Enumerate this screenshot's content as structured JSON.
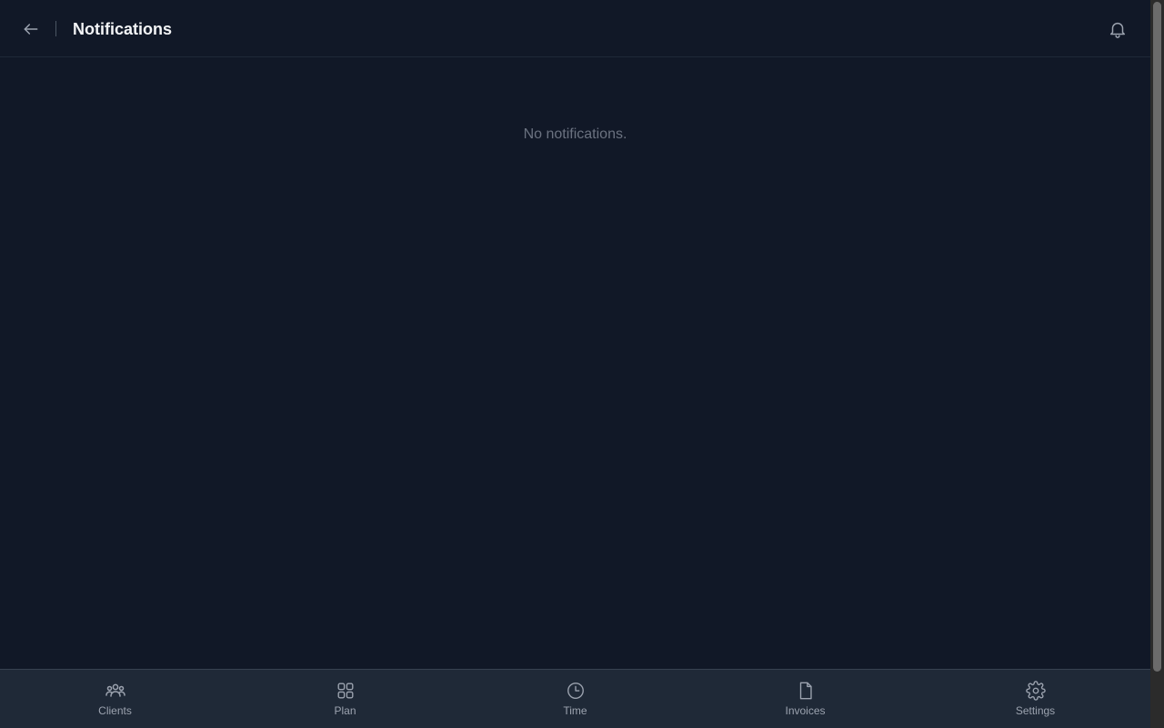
{
  "header": {
    "title": "Notifications",
    "back_icon": "arrow-left-icon",
    "bell_icon": "bell-icon"
  },
  "main": {
    "empty_message": "No notifications."
  },
  "bottom_nav": {
    "items": [
      {
        "label": "Clients",
        "icon": "users-icon"
      },
      {
        "label": "Plan",
        "icon": "grid-icon"
      },
      {
        "label": "Time",
        "icon": "clock-icon"
      },
      {
        "label": "Invoices",
        "icon": "document-icon"
      },
      {
        "label": "Settings",
        "icon": "gear-icon"
      }
    ]
  },
  "colors": {
    "background": "#111827",
    "nav_background": "#1f2937",
    "title": "#f3f4f6",
    "muted": "#6b7280",
    "icon": "#9ca3af"
  }
}
